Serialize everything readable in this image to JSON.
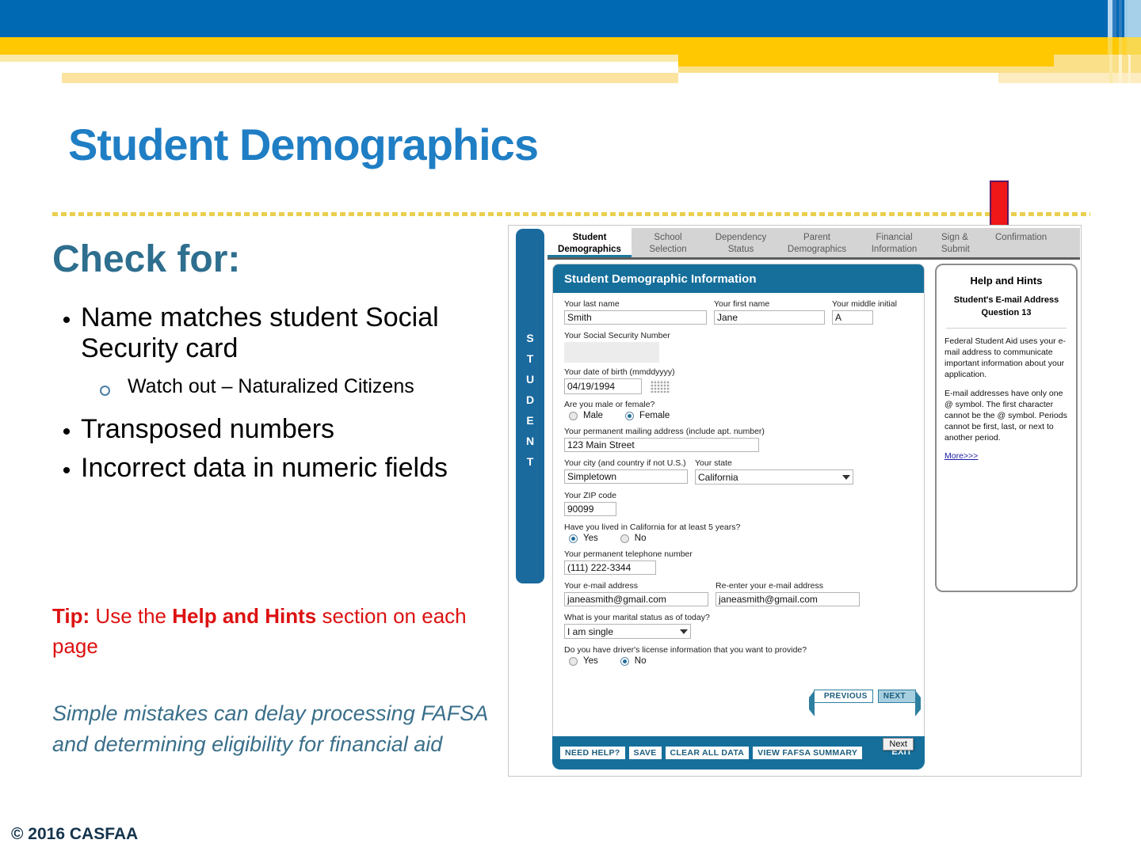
{
  "slide": {
    "title": "Student Demographics",
    "section_heading": "Check for:",
    "bullets": [
      {
        "text": "Name matches student Social Security card",
        "marker": "bullet-dot"
      },
      {
        "text": "Transposed numbers",
        "marker": "bullet-dot"
      },
      {
        "text": "Incorrect data in numeric fields",
        "marker": "bullet-dot"
      }
    ],
    "sub_bullet": {
      "text": "Watch out – Naturalized Citizens",
      "marker": "hollow-circle"
    },
    "tip": {
      "prefix": "Tip:",
      "mid": " Use the ",
      "bold": "Help and Hints",
      "suffix": " section on each page"
    },
    "note": "Simple mistakes can delay processing FAFSA and determining eligibility for financial aid",
    "copyright": "© 2016 CASFAA",
    "colors": {
      "title_blue": "#1f7ec4",
      "heading_teal": "#2e6e8e",
      "tip_red": "#dd1111",
      "note_teal": "#3a6f8a",
      "banner_blue": "#0069b4",
      "banner_yellow": "#ffc800",
      "copyright_navy": "#14344c",
      "arrow_red": "#ef1717",
      "arrow_outline": "#5b1a63"
    }
  },
  "fafsa": {
    "tabs": [
      {
        "label_line1": "Student",
        "label_line2": "Demographics",
        "active": true
      },
      {
        "label_line1": "School",
        "label_line2": "Selection",
        "active": false
      },
      {
        "label_line1": "Dependency",
        "label_line2": "Status",
        "active": false
      },
      {
        "label_line1": "Parent",
        "label_line2": "Demographics",
        "active": false
      },
      {
        "label_line1": "Financial",
        "label_line2": "Information",
        "active": false
      },
      {
        "label_line1": "Sign &",
        "label_line2": "Submit",
        "active": false
      },
      {
        "label_line1": "Confirmation",
        "label_line2": "",
        "active": false
      }
    ],
    "rail_label": "STUDENT",
    "card_title": "Student Demographic Information",
    "fields": {
      "last_name": {
        "label": "Your last name",
        "value": "Smith"
      },
      "first_name": {
        "label": "Your first name",
        "value": "Jane"
      },
      "middle_initial": {
        "label": "Your middle initial",
        "value": "A"
      },
      "ssn": {
        "label": "Your Social Security Number",
        "value": ""
      },
      "dob": {
        "label": "Your date of birth (mmddyyyy)",
        "value": "04/19/1994"
      },
      "gender": {
        "label": "Are you male or female?",
        "options": [
          "Male",
          "Female"
        ],
        "selected": "Female"
      },
      "address": {
        "label": "Your permanent mailing address (include apt. number)",
        "value": "123 Main Street"
      },
      "city": {
        "label": "Your city (and country if not U.S.)",
        "value": "Simpletown"
      },
      "state": {
        "label": "Your state",
        "value": "California"
      },
      "zip": {
        "label": "Your ZIP code",
        "value": "90099"
      },
      "residency": {
        "label": "Have you lived in California for at least 5 years?",
        "options": [
          "Yes",
          "No"
        ],
        "selected": "Yes"
      },
      "phone": {
        "label": "Your permanent telephone number",
        "value": "(111) 222-3344"
      },
      "email": {
        "label": "Your e-mail address",
        "value": "janeasmith@gmail.com"
      },
      "email_confirm": {
        "label": "Re-enter your e-mail address",
        "value": "janeasmith@gmail.com"
      },
      "marital": {
        "label": "What is your marital status as of today?",
        "value": "I am single"
      },
      "drivers_license": {
        "label": "Do you have driver's license information that you want to provide?",
        "options": [
          "Yes",
          "No"
        ],
        "selected": "No"
      }
    },
    "nav": {
      "previous": "PREVIOUS",
      "next": "NEXT"
    },
    "footer_buttons": [
      "NEED HELP?",
      "SAVE",
      "CLEAR ALL DATA",
      "VIEW FAFSA SUMMARY"
    ],
    "exit_label": "EXIT",
    "tooltip": "Next",
    "help": {
      "title": "Help and Hints",
      "subtitle": "Student's E-mail Address",
      "question": "Question 13",
      "paragraphs": [
        "Federal Student Aid uses your e-mail address to communicate important information about your application.",
        "E-mail addresses have only one @ symbol. The first character cannot be the @ symbol. Periods cannot be first, last, or next to another period."
      ],
      "more_link": "More>>>"
    }
  }
}
